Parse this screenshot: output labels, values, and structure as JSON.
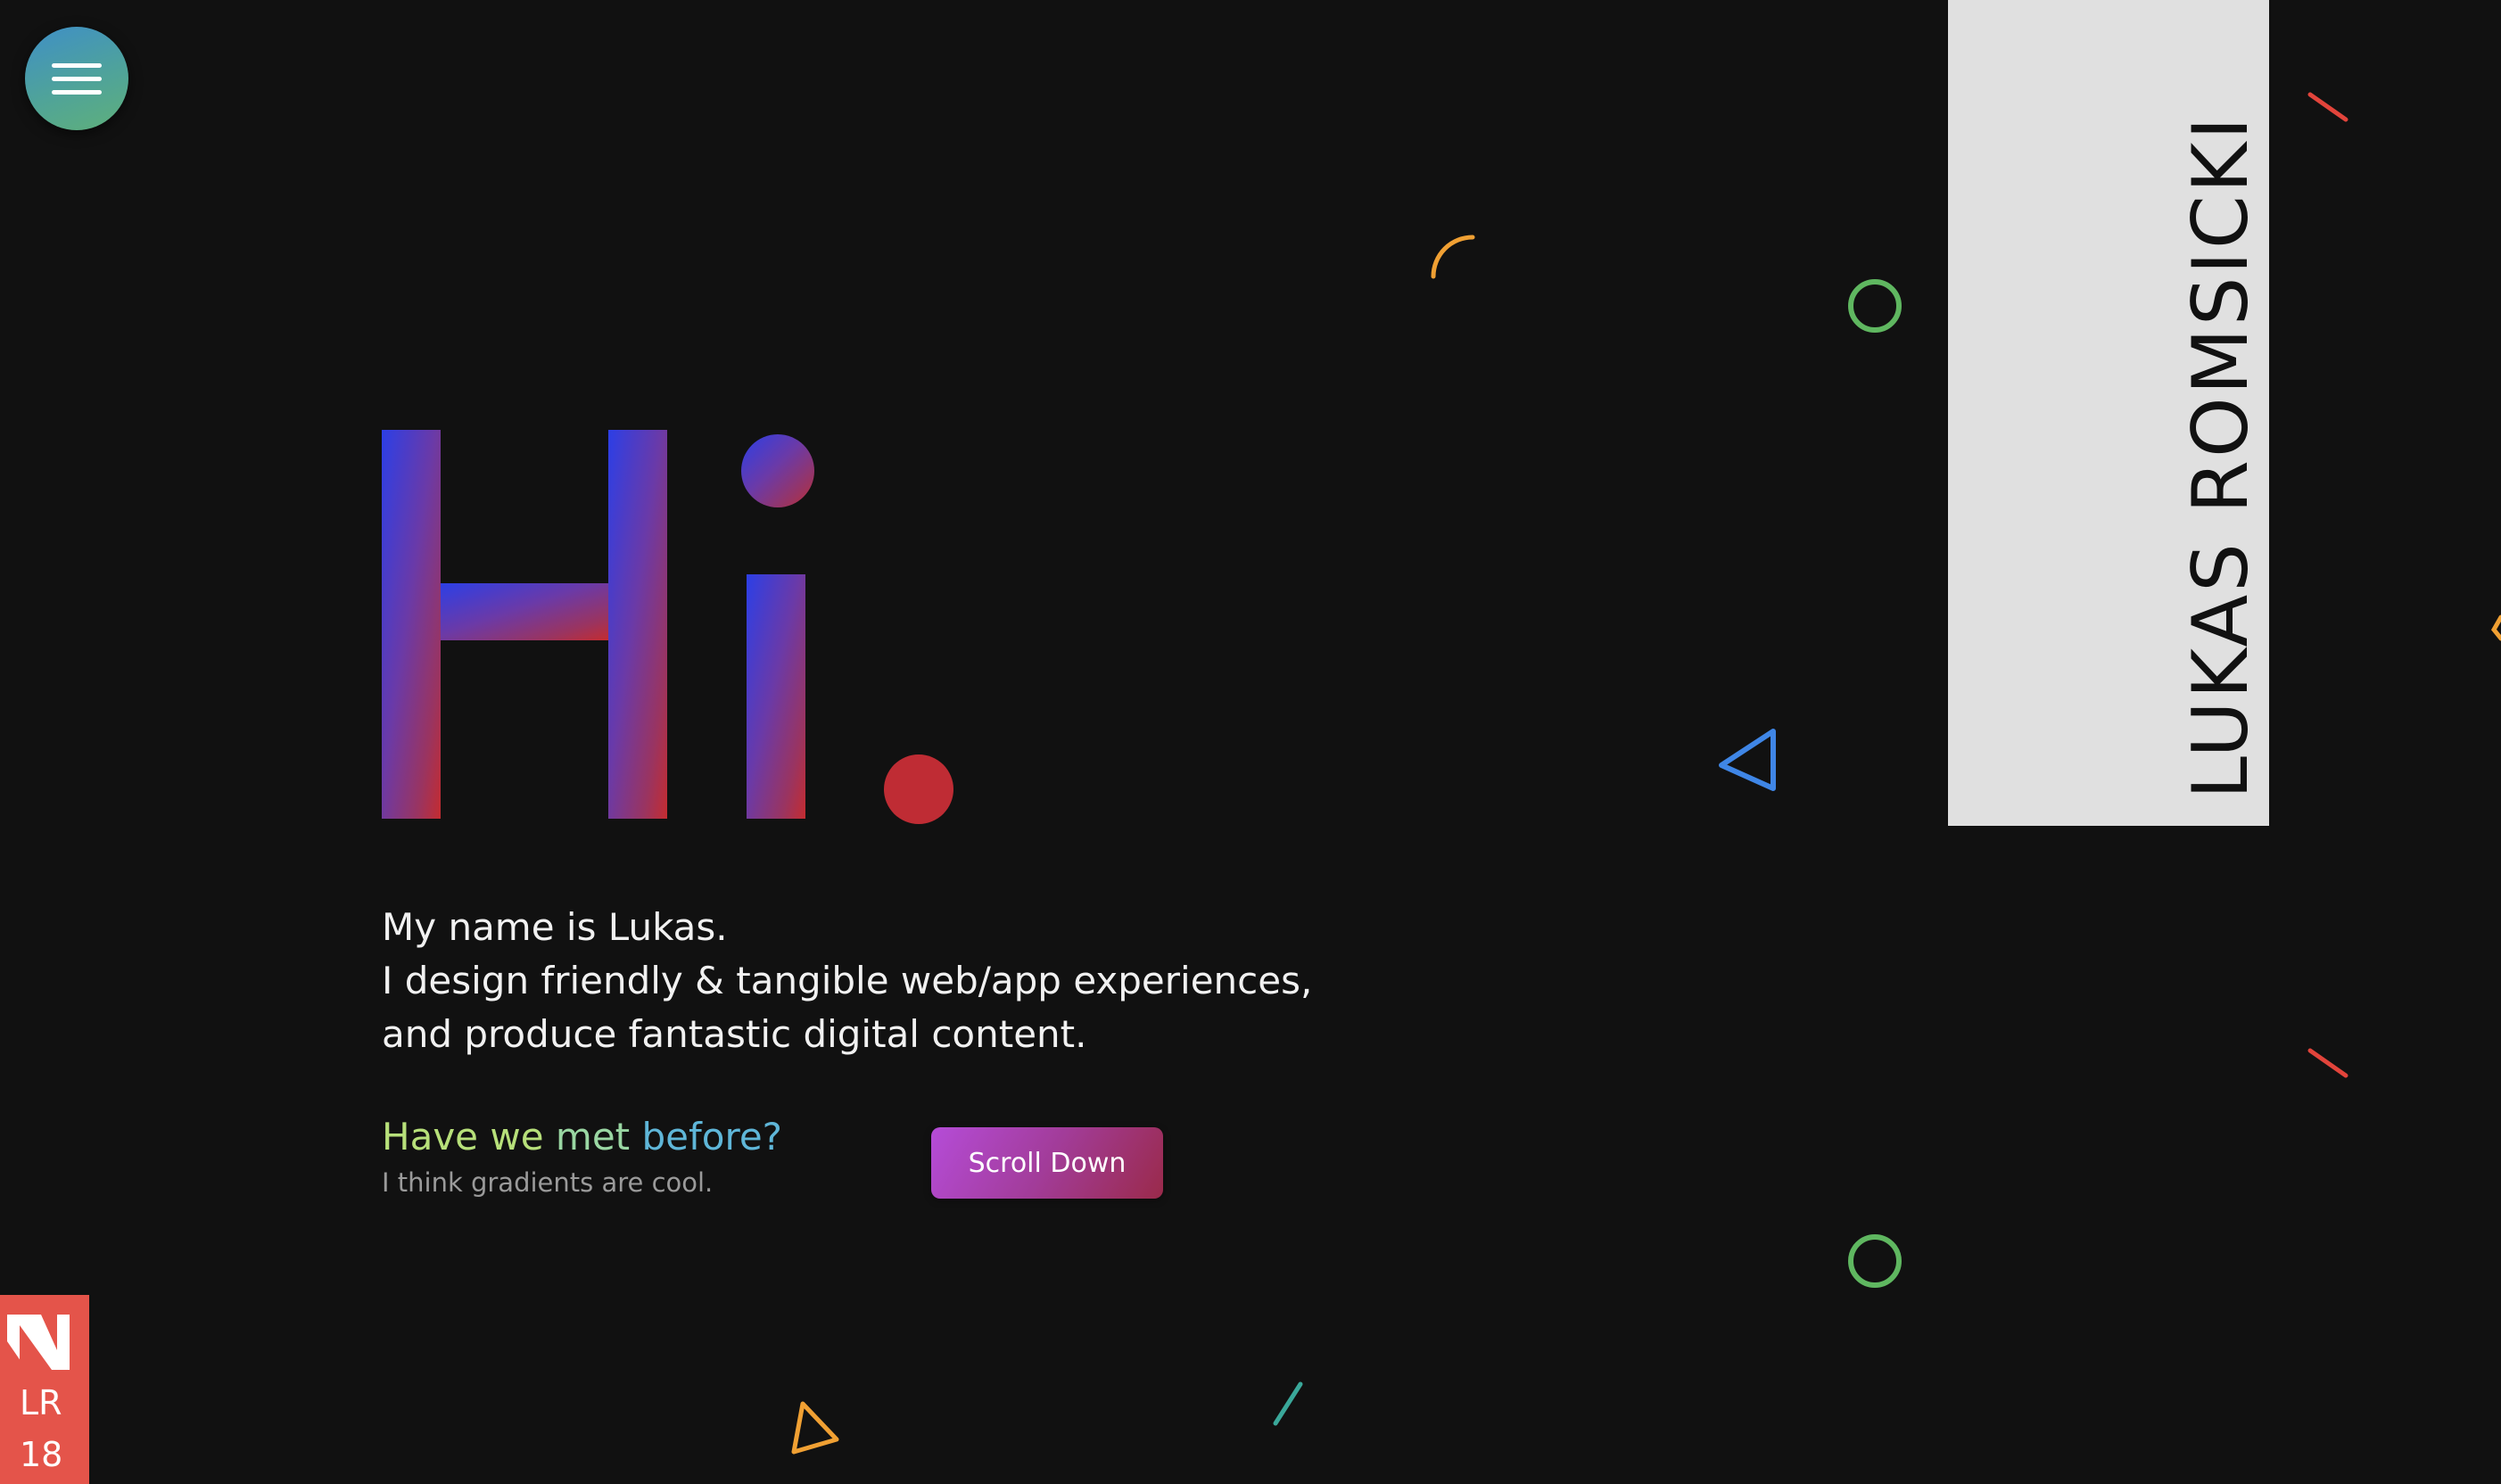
{
  "menu": {
    "icon": "hamburger-menu-icon"
  },
  "hero": {
    "greeting": "Hi",
    "greeting_dot": ".",
    "gradient_start": "#2c3fe6",
    "gradient_end": "#c42c30"
  },
  "intro": {
    "line1": "My name is Lukas.",
    "line2": "I design friendly & tangible web/app experiences,",
    "line3": "and produce fantastic digital content."
  },
  "met": {
    "title_part1": "Have we",
    "title_part2": "met",
    "title_part3": "before?",
    "subtitle": "I think gradients are cool."
  },
  "scroll_button": {
    "label": "Scroll Down"
  },
  "name_panel": {
    "name": "LUKAS ROMSICKI"
  },
  "logo": {
    "line1": "LR",
    "line2": "18",
    "color": "#e4544a"
  },
  "decorations": {
    "icons": [
      "orange-arc-icon",
      "green-circle-icon",
      "blue-triangle-icon",
      "red-line-icon",
      "teal-line-icon",
      "orange-triangle-icon"
    ]
  }
}
